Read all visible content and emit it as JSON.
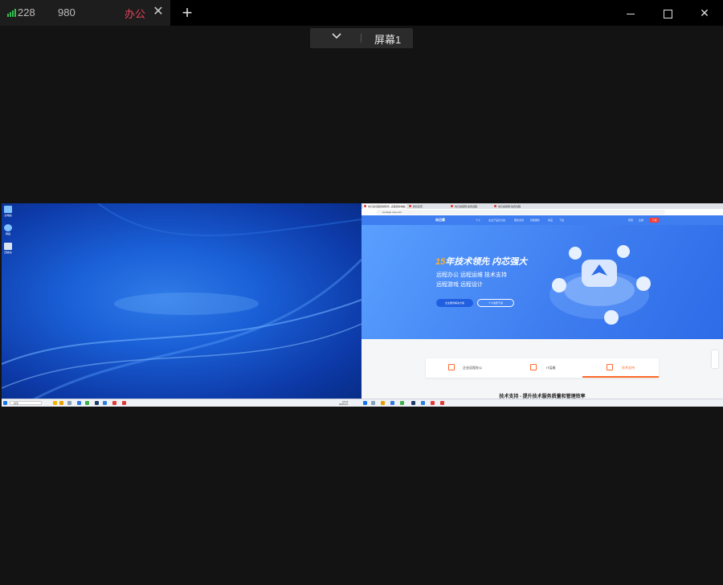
{
  "tab": {
    "id_part1": "228",
    "id_part2": "980",
    "name": "办公",
    "close_glyph": "✕",
    "signal_icon": "signal-bars-icon",
    "signal_color": "#2fbf4f",
    "name_color": "#e8415a"
  },
  "toolbar": {
    "new_tab_glyph": "+",
    "minimize_icon": "minimize-icon",
    "maximize_icon": "maximize-icon",
    "close_glyph": "✕"
  },
  "screen_selector": {
    "label": "屏幕1",
    "chevron_icon": "chevron-down-icon"
  },
  "left_desktop": {
    "icons": [
      "此电脑",
      "网络",
      "回收站"
    ],
    "search_text": "搜索",
    "clock_time": "15:01",
    "clock_date": "2025/1/1"
  },
  "right_desktop": {
    "browser_tabs": [
      "向日葵远程控制软件_远程控制电脑",
      "新标签页",
      "向日葵官网-免费远程",
      "向日葵官网-免费远程"
    ],
    "url": "sunlogin.oray.com",
    "site": {
      "logo": "向日葵",
      "nav_items": [
        "个人",
        "企业产品及方案",
        "服务支持",
        "智能硬件",
        "商店",
        "下载"
      ],
      "right_items": [
        "登录",
        "注册"
      ],
      "cta": "下载",
      "hero_title_num": "15",
      "hero_title_rest": "年技术领先 内芯强大",
      "hero_line1": "远程办公  远程运维  技术支持",
      "hero_line2": "远程游戏  远程设计",
      "hero_btn_primary": "企业服务解决方案",
      "hero_btn_secondary": "个人免费下载",
      "features": [
        "企业远程办公",
        "IT运维",
        "技术支持"
      ],
      "section_title": "技术支持 - 提升技术服务质量和管理效率"
    }
  },
  "colors": {
    "accent_orange": "#ff6a2a",
    "site_blue": "#3f7ef0",
    "app_bg": "#131313"
  }
}
